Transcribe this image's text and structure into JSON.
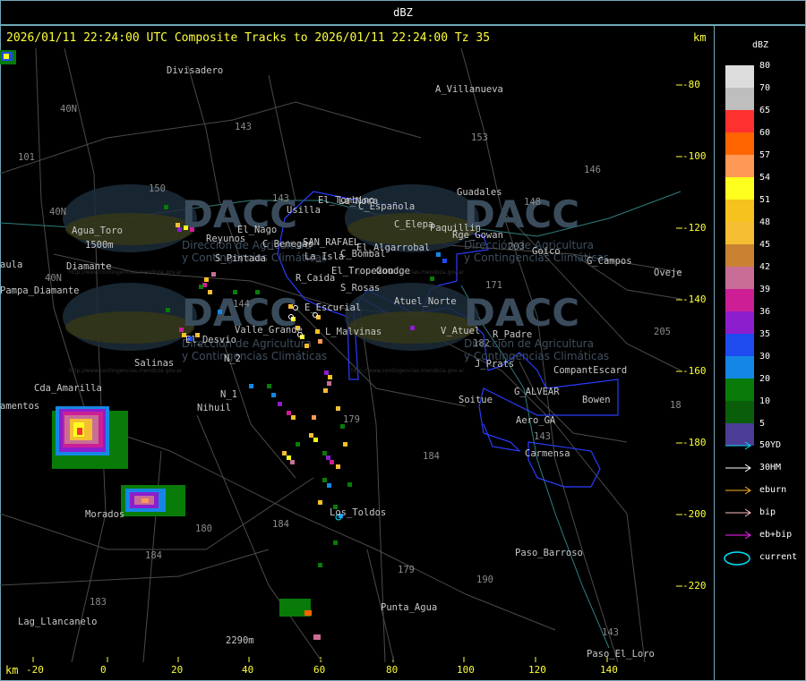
{
  "window": {
    "title": "dBZ"
  },
  "header": {
    "text": "2026/01/11 22:24:00 UTC Composite Tracks to 2026/01/11 22:24:00 Tz 35",
    "unit": "km"
  },
  "x_axis": {
    "unit": "km",
    "ticks": [
      "-20",
      "0",
      "20",
      "40",
      "60",
      "80",
      "100",
      "120",
      "140"
    ]
  },
  "y_axis": {
    "ticks": [
      "-80",
      "-100",
      "-120",
      "-140",
      "-160",
      "-180",
      "-200",
      "-220"
    ]
  },
  "places": [
    "Divisadero",
    "A_Villanueva",
    "Guadales",
    "El_Tombino",
    "Usilla",
    "La_Nora",
    "C_Española",
    "C_Elepa",
    "Paquillin",
    "Rge_Gowan",
    "Reyunos",
    "El_Nago",
    "C_Benegas",
    "SAN_RAFAEL",
    "El_Algarrobal",
    "C_Bombal",
    "Goico",
    "G_Campos",
    "Oveje",
    "S_Pintada",
    "La_Isla",
    "El_Tropezon",
    "Goudge",
    "R_Caida",
    "S_Rosas",
    "Atuel_Norte",
    "E_Escurial",
    "V_Atuel",
    "R_Padre",
    "Valle_Grande",
    "L_Malvinas",
    "El_Desvio",
    "J_Prats",
    "CompantEscard",
    "Salinas",
    "N_2",
    "N_1",
    "G_ALVEAR",
    "Soitue",
    "Bowen",
    "Aero_GA",
    "Nihuil",
    "Cda_Amarilla",
    "amentos",
    "Carmensa",
    "Morados",
    "Los_Toldos",
    "Paso_Barroso",
    "Punta_Agua",
    "Lag_Llancanelo",
    "Paso_El_Loro",
    "2290m",
    "Agua_Toro",
    "1500m",
    "Diamante",
    "Pampa_Diamante",
    "aula"
  ],
  "route_numbers": [
    "143",
    "153",
    "146",
    "101",
    "40N",
    "150",
    "143",
    "148",
    "203",
    "144",
    "171",
    "40N",
    "40N",
    "182",
    "179",
    "184",
    "180",
    "184",
    "179",
    "190",
    "184",
    "183",
    "143",
    "143",
    "205",
    "18"
  ],
  "watermark": {
    "logo": "DACC",
    "line1": "Dirección de Agricultura",
    "line2": "y Contingencias Climáticas",
    "url": "http://www.contingencias.mendoza.gov.ar"
  },
  "legend": {
    "title": "dBZ",
    "levels": [
      {
        "label": "80",
        "color": "#dcdcdc"
      },
      {
        "label": "70",
        "color": "#bebebe"
      },
      {
        "label": "65",
        "color": "#ff3030"
      },
      {
        "label": "60",
        "color": "#ff6400"
      },
      {
        "label": "57",
        "color": "#ff9955"
      },
      {
        "label": "54",
        "color": "#ffff1e"
      },
      {
        "label": "51",
        "color": "#f5c21e"
      },
      {
        "label": "48",
        "color": "#f5be32"
      },
      {
        "label": "45",
        "color": "#c88232"
      },
      {
        "label": "42",
        "color": "#c86e96"
      },
      {
        "label": "39",
        "color": "#cd1e96"
      },
      {
        "label": "36",
        "color": "#8c1ecd"
      },
      {
        "label": "35",
        "color": "#1e4bf0"
      },
      {
        "label": "30",
        "color": "#1487e6"
      },
      {
        "label": "20",
        "color": "#087b08"
      },
      {
        "label": "10",
        "color": "#0a5e0a"
      },
      {
        "label": "5",
        "color": "#4b3c96"
      }
    ],
    "tracks": [
      {
        "label": "50YD",
        "color": "#00e0ff"
      },
      {
        "label": "30HM",
        "color": "#ffffff"
      },
      {
        "label": "eburn",
        "color": "#ffb020"
      },
      {
        "label": "bip",
        "color": "#ffc0c0"
      },
      {
        "label": "eb+bip",
        "color": "#ff20ff"
      }
    ],
    "current": {
      "label": "current",
      "color": "#00e5ff"
    }
  }
}
